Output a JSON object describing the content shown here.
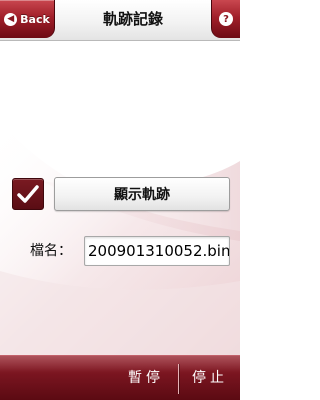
{
  "header": {
    "back_label": "Back",
    "back_icon": "back-arrow-icon",
    "title": "軌跡記錄",
    "help_icon": "help-question-icon",
    "help_glyph": "?"
  },
  "main": {
    "show_track_checked": true,
    "show_track_label": "顯示軌跡",
    "filename_label": "檔名：",
    "filename_value": "200901310052.bin"
  },
  "footer": {
    "pause_label": "暫停",
    "stop_label": "停止"
  },
  "colors": {
    "accent": "#8a1620",
    "accent_dark": "#5a0a12",
    "title_bar": "#f3f3f3",
    "background": "#ffffff"
  }
}
